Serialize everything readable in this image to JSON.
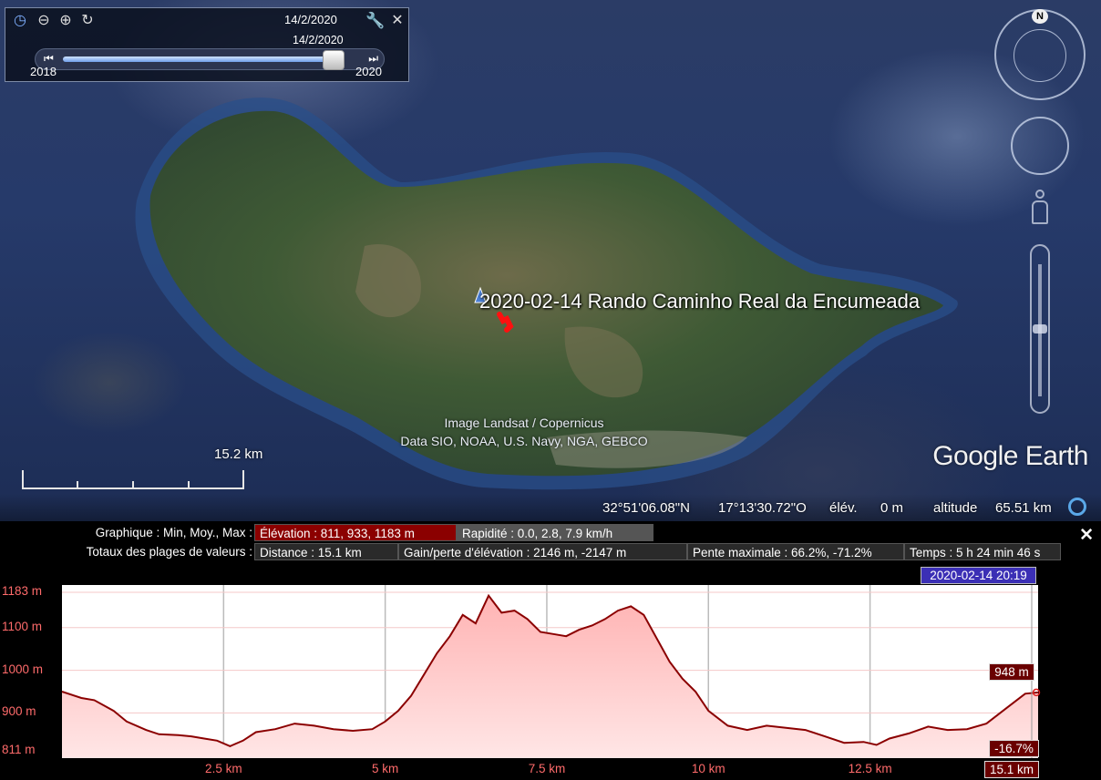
{
  "time_slider": {
    "current_date": "14/2/2020",
    "thumb_date": "14/2/2020",
    "start_year": "2018",
    "end_year": "2020",
    "position_fraction": 0.97
  },
  "map": {
    "track_title": "2020-02-14 Rando Caminho Real da Encumeada",
    "credit_line1": "Image Landsat / Copernicus",
    "credit_line2": "Data SIO, NOAA, U.S. Navy, NGA, GEBCO",
    "logo": "Google Earth",
    "scale_label": "15.2  km",
    "compass_letter": "N"
  },
  "status_bar": {
    "latitude": "32°51'06.08\"N",
    "longitude": "17°13'30.72\"O",
    "elevation_label": "élév.",
    "elevation_value": "0 m",
    "altitude_label": "altitude",
    "altitude_value": "65.51 km"
  },
  "profile": {
    "row1_label": "Graphique : Min, Moy., Max :",
    "elevation_stat": "Élévation : 811, 933, 1183 m",
    "speed_stat": "Rapidité : 0.0, 2.8, 7.9 km/h",
    "row2_label": "Totaux des plages de valeurs :",
    "distance": "Distance : 15.1 km",
    "gain_loss": "Gain/perte d'élévation : 2146 m, -2147 m",
    "max_slope": "Pente maximale : 66.2%, -71.2%",
    "time": "Temps : 5 h 24 min 46 s",
    "cursor_datetime": "2020-02-14 20:19",
    "cursor_elevation": "948 m",
    "cursor_slope": "-16.7%",
    "cursor_distance": "15.1 km",
    "close_symbol": "✕"
  },
  "chart_data": {
    "type": "area",
    "title": "",
    "xlabel": "",
    "ylabel": "",
    "x_ticks": [
      "2.5 km",
      "5 km",
      "7.5 km",
      "10 km",
      "12.5 km"
    ],
    "x_tick_values": [
      2.5,
      5,
      7.5,
      10,
      12.5
    ],
    "y_ticks": [
      "1183 m",
      "1100 m",
      "1000 m",
      "900 m",
      "811 m"
    ],
    "y_tick_values": [
      1183,
      1100,
      1000,
      900,
      811
    ],
    "xlim": [
      0,
      15.1
    ],
    "ylim": [
      794,
      1200
    ],
    "colors": {
      "line": "#8b0000",
      "fill_top": "#ffb3b3",
      "fill_bottom": "#ffe6e6"
    },
    "x": [
      0,
      0.3,
      0.5,
      0.8,
      1.0,
      1.3,
      1.5,
      1.8,
      2.0,
      2.2,
      2.4,
      2.6,
      2.8,
      3.0,
      3.3,
      3.6,
      3.9,
      4.2,
      4.5,
      4.8,
      5.0,
      5.2,
      5.4,
      5.6,
      5.8,
      6.0,
      6.2,
      6.4,
      6.6,
      6.8,
      7.0,
      7.2,
      7.4,
      7.6,
      7.8,
      8.0,
      8.2,
      8.4,
      8.6,
      8.8,
      9.0,
      9.2,
      9.4,
      9.6,
      9.8,
      10.0,
      10.3,
      10.6,
      10.9,
      11.2,
      11.5,
      11.8,
      12.1,
      12.4,
      12.6,
      12.8,
      13.1,
      13.4,
      13.7,
      14.0,
      14.3,
      14.6,
      14.9,
      15.1
    ],
    "y": [
      950,
      935,
      930,
      905,
      880,
      860,
      850,
      848,
      845,
      840,
      835,
      822,
      835,
      855,
      862,
      875,
      870,
      862,
      858,
      862,
      880,
      905,
      940,
      990,
      1040,
      1080,
      1130,
      1110,
      1175,
      1135,
      1140,
      1120,
      1090,
      1085,
      1080,
      1095,
      1105,
      1120,
      1140,
      1150,
      1130,
      1075,
      1020,
      980,
      950,
      905,
      870,
      860,
      870,
      865,
      860,
      845,
      830,
      832,
      825,
      840,
      852,
      868,
      860,
      862,
      875,
      910,
      945,
      948
    ]
  }
}
